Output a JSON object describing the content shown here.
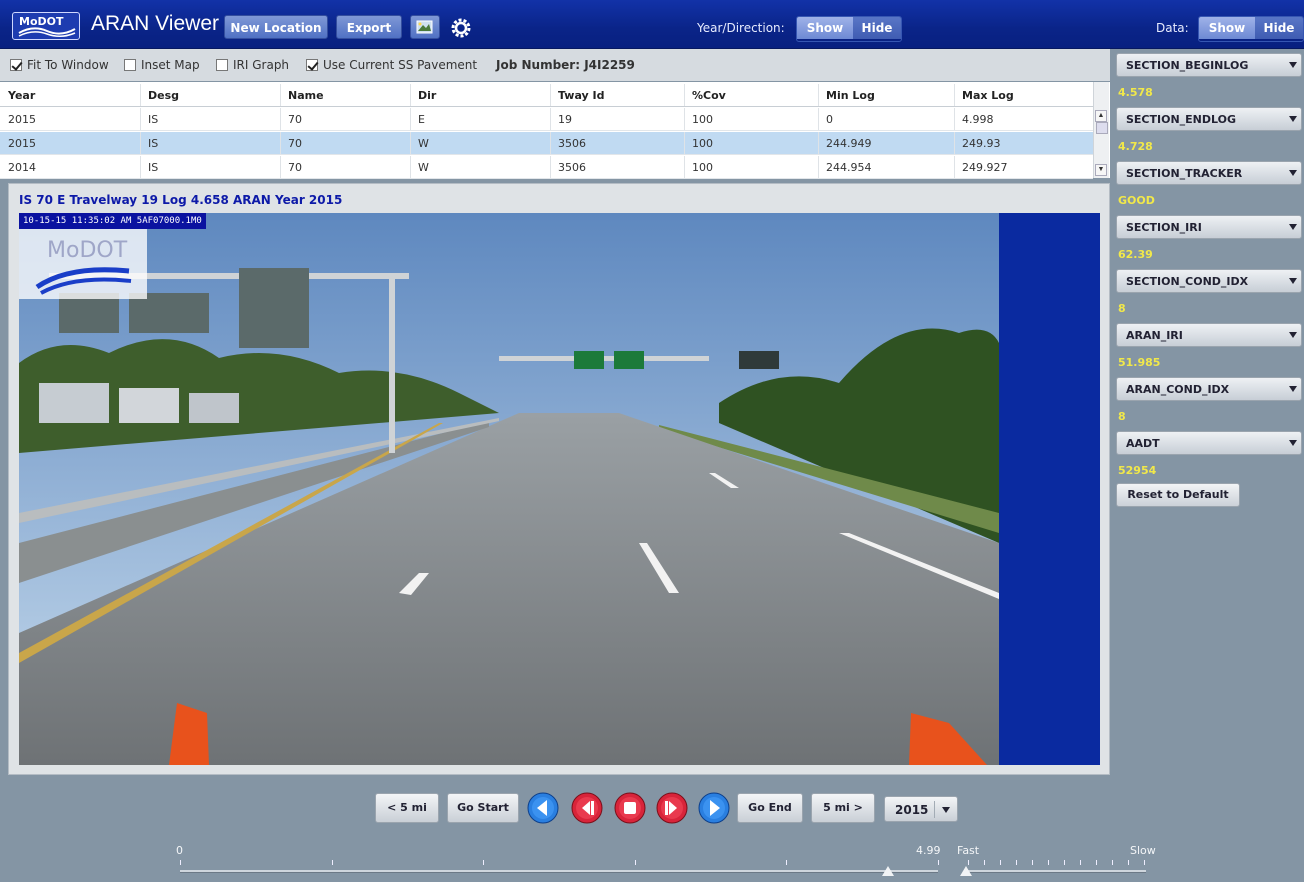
{
  "header": {
    "logo_text": "MoDOT",
    "title": "ARAN Viewer",
    "new_location_label": "New Location",
    "export_label": "Export",
    "year_direction_label": "Year/Direction:",
    "year_direction_show": "Show",
    "year_direction_hide": "Hide",
    "data_label": "Data:",
    "data_show": "Show",
    "data_hide": "Hide",
    "icons": [
      "map-image-icon",
      "gear-icon"
    ]
  },
  "toolbar": {
    "fit_to_window": {
      "label": "Fit To Window",
      "checked": true
    },
    "inset_map": {
      "label": "Inset Map",
      "checked": false
    },
    "iri_graph": {
      "label": "IRI Graph",
      "checked": false
    },
    "use_current_ss": {
      "label": "Use Current SS Pavement",
      "checked": true
    },
    "job_number": "Job Number: J4I2259"
  },
  "table": {
    "columns": [
      "Year",
      "Desg",
      "Name",
      "Dir",
      "Tway Id",
      "%Cov",
      "Min Log",
      "Max Log"
    ],
    "rows": [
      [
        "2015",
        "IS",
        "70",
        "E",
        "19",
        "100",
        "0",
        "4.998"
      ],
      [
        "2015",
        "IS",
        "70",
        "W",
        "3506",
        "100",
        "244.949",
        "249.93"
      ],
      [
        "2014",
        "IS",
        "70",
        "W",
        "3506",
        "100",
        "244.954",
        "249.927"
      ]
    ],
    "selected_row": 1
  },
  "image_panel": {
    "title": "IS 70 E Travelway 19 Log 4.658 ARAN Year 2015",
    "timestamp": "10-15-15 11:35:02 AM  5AF07000.1M0",
    "watermark": "MoDOT"
  },
  "data_panel": [
    {
      "field": "SECTION_BEGINLOG",
      "value": "4.578"
    },
    {
      "field": "SECTION_ENDLOG",
      "value": "4.728"
    },
    {
      "field": "SECTION_TRACKER",
      "value": "GOOD"
    },
    {
      "field": "SECTION_IRI",
      "value": "62.39"
    },
    {
      "field": "SECTION_COND_IDX",
      "value": "8"
    },
    {
      "field": "ARAN_IRI",
      "value": "51.985"
    },
    {
      "field": "ARAN_COND_IDX",
      "value": "8"
    },
    {
      "field": "AADT",
      "value": "52954"
    }
  ],
  "reset_label": "Reset to Default",
  "controls": {
    "back5": "< 5 mi",
    "go_start": "Go Start",
    "go_end": "Go End",
    "fwd5": "5 mi >",
    "year": "2015",
    "icons": [
      "play-reverse-icon",
      "step-back-icon",
      "stop-icon",
      "step-forward-icon",
      "play-forward-icon"
    ]
  },
  "log_slider": {
    "min_label": "0",
    "max_label": "4.99",
    "value": 4.658,
    "min": 0,
    "max": 4.99
  },
  "speed_slider": {
    "fast_label": "Fast",
    "slow_label": "Slow",
    "value_fraction": 0
  }
}
